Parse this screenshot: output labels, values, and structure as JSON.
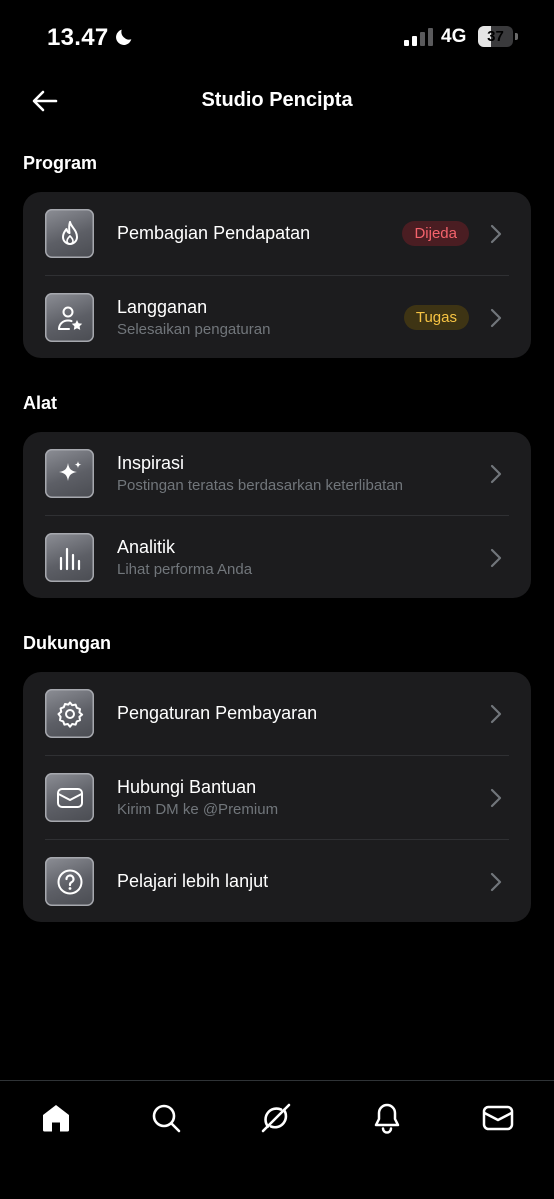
{
  "status_bar": {
    "time": "13.47",
    "network": "4G",
    "battery_level": "37",
    "battery_fraction": 0.37
  },
  "header": {
    "title": "Studio Pencipta",
    "back_icon": "arrow-left-icon"
  },
  "sections": [
    {
      "title": "Program",
      "items": [
        {
          "title": "Pembagian Pendapatan",
          "subtitle": "",
          "badge": "Dijeda",
          "badge_color": "#f4636c",
          "icon": "flame-icon"
        },
        {
          "title": "Langganan",
          "subtitle": "Selesaikan pengaturan",
          "badge": "Tugas",
          "badge_color": "#f6c343",
          "icon": "user-star-icon"
        }
      ]
    },
    {
      "title": "Alat",
      "items": [
        {
          "title": "Inspirasi",
          "subtitle": "Postingan teratas berdasarkan keterlibatan",
          "icon": "sparkle-icon"
        },
        {
          "title": "Analitik",
          "subtitle": "Lihat performa Anda",
          "icon": "bar-chart-icon"
        }
      ]
    },
    {
      "title": "Dukungan",
      "items": [
        {
          "title": "Pengaturan Pembayaran",
          "subtitle": "",
          "icon": "gear-icon"
        },
        {
          "title": "Hubungi Bantuan",
          "subtitle": "Kirim DM ke @Premium",
          "icon": "mail-icon"
        },
        {
          "title": "Pelajari lebih lanjut",
          "subtitle": "",
          "icon": "help-circle-icon"
        }
      ]
    }
  ],
  "bottom_nav": [
    "home-icon",
    "search-icon",
    "grok-icon",
    "bell-icon",
    "mail-icon"
  ],
  "colors": {
    "background": "#000000",
    "card": "#1c1c1e",
    "muted_text": "#71767b"
  }
}
